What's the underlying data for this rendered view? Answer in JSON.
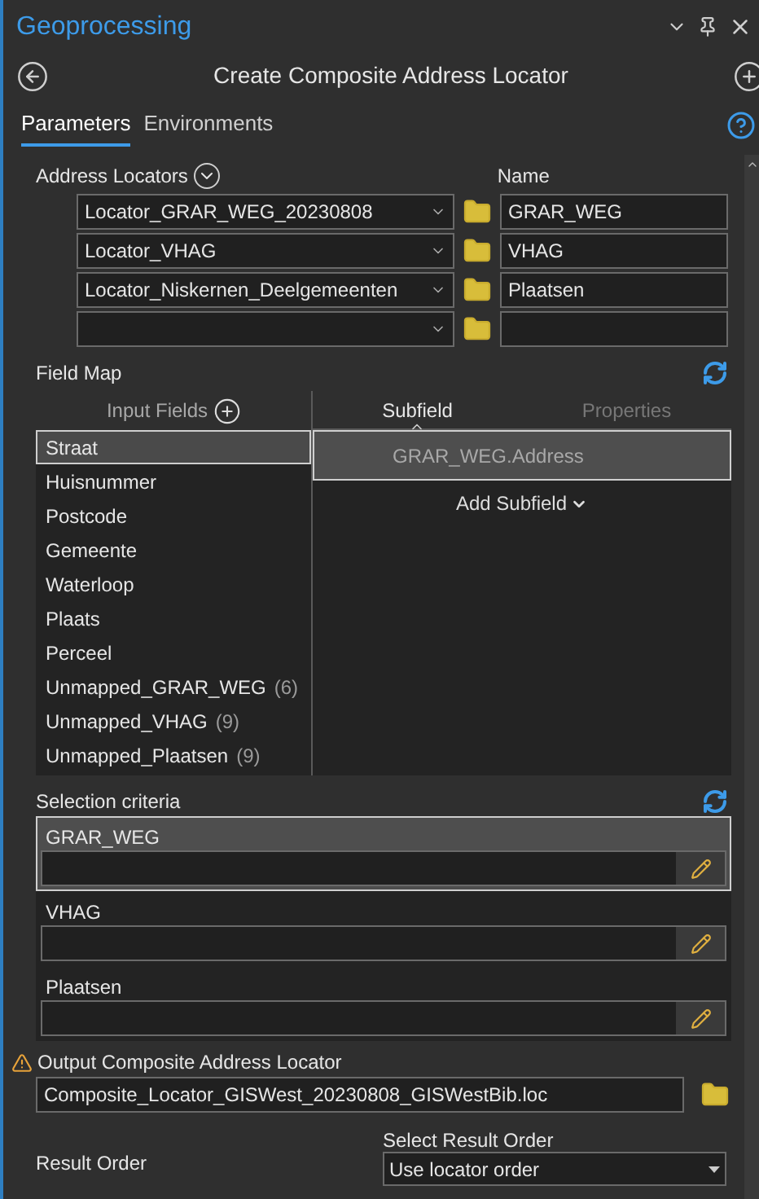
{
  "panel": {
    "title": "Geoprocessing"
  },
  "tool": {
    "title": "Create Composite Address Locator"
  },
  "tabs": [
    {
      "label": "Parameters",
      "selected": true
    },
    {
      "label": "Environments",
      "selected": false
    }
  ],
  "address_locators": {
    "label": "Address Locators",
    "name_label": "Name",
    "rows": [
      {
        "locator": "Locator_GRAR_WEG_20230808",
        "name": "GRAR_WEG"
      },
      {
        "locator": "Locator_VHAG",
        "name": "VHAG"
      },
      {
        "locator": "Locator_Niskernen_Deelgemeenten",
        "name": "Plaatsen"
      },
      {}
    ]
  },
  "field_map": {
    "label": "Field Map",
    "input_fields_label": "Input Fields",
    "tabs": [
      {
        "label": "Subfield",
        "selected": true
      },
      {
        "label": "Properties",
        "selected": false
      }
    ],
    "input_fields": [
      {
        "name": "Straat",
        "selected": true
      },
      {
        "name": "Huisnummer",
        "selected": false
      },
      {
        "name": "Postcode",
        "selected": false
      },
      {
        "name": "Gemeente",
        "selected": false
      },
      {
        "name": "Waterloop",
        "selected": false
      },
      {
        "name": "Plaats",
        "selected": false
      },
      {
        "name": "Perceel",
        "selected": false
      },
      {
        "name": "Unmapped_GRAR_WEG",
        "count": "(6)",
        "selected": false
      },
      {
        "name": "Unmapped_VHAG",
        "count": "(9)",
        "selected": false
      },
      {
        "name": "Unmapped_Plaatsen",
        "count": "(9)",
        "selected": false
      }
    ],
    "subfields": [
      {
        "name": "GRAR_WEG.Address",
        "selected": true
      }
    ],
    "add_subfield": "Add Subfield"
  },
  "selection_criteria": {
    "label": "Selection criteria",
    "items": [
      {
        "name": "GRAR_WEG",
        "selected": true
      },
      {
        "name": "VHAG",
        "selected": false
      },
      {
        "name": "Plaatsen",
        "selected": false
      }
    ]
  },
  "output": {
    "label": "Output Composite Address Locator",
    "warning": true,
    "value": "Composite_Locator_GISWest_20230808_GISWestBib.loc"
  },
  "result_order": {
    "label": "Result Order",
    "select_label": "Select Result Order",
    "value": "Use locator order"
  }
}
